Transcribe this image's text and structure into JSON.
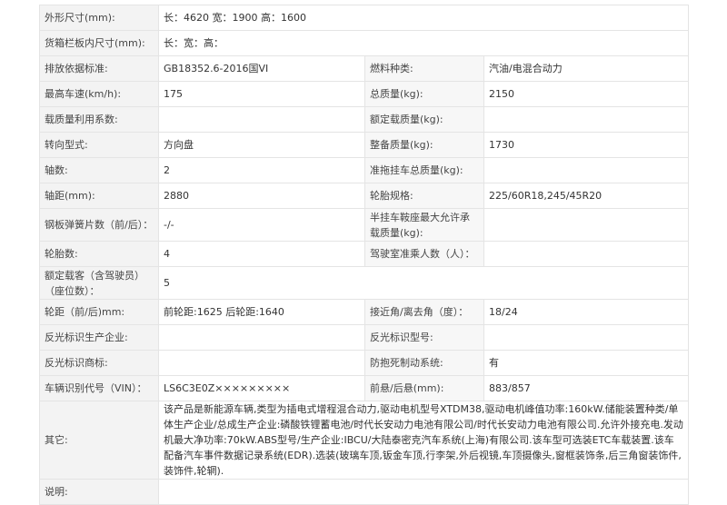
{
  "rows": [
    {
      "l1": "外形尺寸(mm):",
      "v1": "长：4620 宽：1900 高：1600",
      "l2": "",
      "v2": ""
    },
    {
      "l1": "货箱栏板内尺寸(mm):",
      "v1": "长：宽：高：",
      "l2": "",
      "v2": ""
    },
    {
      "l1": "排放依据标准:",
      "v1": "GB18352.6-2016国VI",
      "l2": "燃料种类:",
      "v2": "汽油/电混合动力"
    },
    {
      "l1": "最高车速(km/h):",
      "v1": "175",
      "l2": "总质量(kg):",
      "v2": "2150"
    },
    {
      "l1": "载质量利用系数:",
      "v1": "",
      "l2": "额定载质量(kg):",
      "v2": ""
    },
    {
      "l1": "转向型式:",
      "v1": "方向盘",
      "l2": "整备质量(kg):",
      "v2": "1730"
    },
    {
      "l1": "轴数:",
      "v1": "2",
      "l2": "准拖挂车总质量(kg):",
      "v2": ""
    },
    {
      "l1": "轴距(mm):",
      "v1": "2880",
      "l2": "轮胎规格:",
      "v2": "225/60R18,245/45R20"
    },
    {
      "l1": "钢板弹簧片数（前/后）：",
      "v1": "-/-",
      "l2": "半挂车鞍座最大允许承载质量(kg):",
      "v2": ""
    },
    {
      "l1": "轮胎数:",
      "v1": "4",
      "l2": "驾驶室准乘人数（人）：",
      "v2": ""
    },
    {
      "l1": "额定载客（含驾驶员）（座位数）：",
      "v1": "5",
      "l2": "",
      "v2": ""
    },
    {
      "l1": "轮距（前/后)mm:",
      "v1": "前轮距:1625 后轮距:1640",
      "l2": "接近角/离去角（度）：",
      "v2": "18/24"
    },
    {
      "l1": "反光标识生产企业:",
      "v1": "",
      "l2": "反光标识型号:",
      "v2": ""
    },
    {
      "l1": "反光标识商标:",
      "v1": "",
      "l2": "防抱死制动系统:",
      "v2": "有"
    },
    {
      "l1": "车辆识别代号（VIN）：",
      "v1": "LS6C3E0Z×××××××××",
      "l2": "前悬/后悬(mm):",
      "v2": "883/857"
    }
  ],
  "remarks": {
    "label": "其它:",
    "text": "该产品是新能源车辆,类型为插电式增程混合动力,驱动电机型号XTDM38,驱动电机峰值功率:160kW.储能装置种类/单体生产企业/总成生产企业:磷酸铁锂蓄电池/时代长安动力电池有限公司/时代长安动力电池有限公司.允许外接充电.发动机最大净功率:70kW.ABS型号/生产企业:IBCU/大陆泰密克汽车系统(上海)有限公司.该车型可选装ETC车载装置.该车配备汽车事件数据记录系统(EDR).选装(玻璃车顶,钣金车顶,行李架,外后视镜,车顶摄像头,窗框装饰条,后三角窗装饰件,装饰件,轮辋)."
  },
  "notes": {
    "label": "说明:",
    "text": ""
  }
}
